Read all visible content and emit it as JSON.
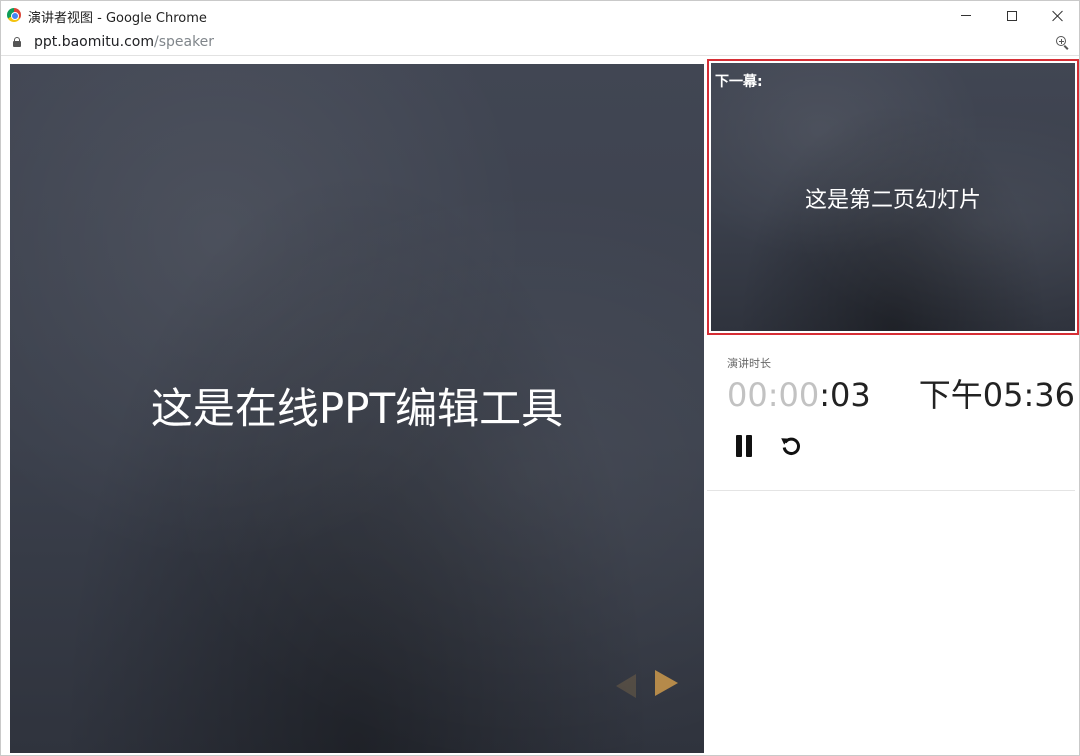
{
  "window": {
    "title": "演讲者视图 - Google Chrome"
  },
  "address_bar": {
    "host": "ppt.baomitu.com",
    "path": "/speaker"
  },
  "main_slide": {
    "text": "这是在线PPT编辑工具"
  },
  "next_slide": {
    "label": "下一幕:",
    "text": "这是第二页幻灯片",
    "border_color": "#d62e35"
  },
  "timer": {
    "label": "演讲时长",
    "elapsed_dim": "00:00",
    "elapsed_live": ":03",
    "clock": "下午05:36"
  },
  "icons": {
    "lock": "lock-icon",
    "zoom": "zoom-in-icon",
    "pause": "pause-icon",
    "reset": "reset-icon",
    "prev": "triangle-left-icon",
    "next": "triangle-right-icon"
  },
  "colors": {
    "accent_nav": "#b58a4a",
    "chalkboard": "#3e4350"
  }
}
